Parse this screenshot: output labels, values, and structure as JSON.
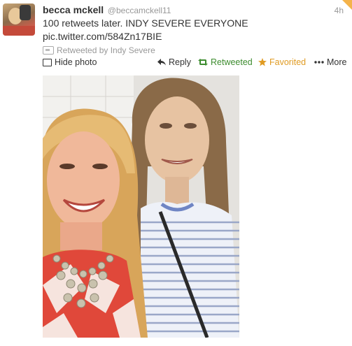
{
  "tweet": {
    "full_name": "becca mckell",
    "username": "@beccamckell11",
    "time": "4h",
    "text": "100 retweets later. INDY SEVERE EVERYONE",
    "link": "pic.twitter.com/584Zn17BIE",
    "retweet_context": "Retweeted by Indy Severe"
  },
  "actions": {
    "hide_photo": "Hide photo",
    "reply": "Reply",
    "retweeted": "Retweeted",
    "favorited": "Favorited",
    "more": "More"
  },
  "icons": {
    "hide_photo": "photo-icon",
    "reply": "reply-arrow-icon",
    "retweet": "retweet-icon",
    "favorite": "star-icon",
    "more": "ellipsis-icon"
  },
  "colors": {
    "retweeted": "#3d8c2f",
    "favorited": "#e09b23",
    "corner_badge": "#f4b34a"
  }
}
